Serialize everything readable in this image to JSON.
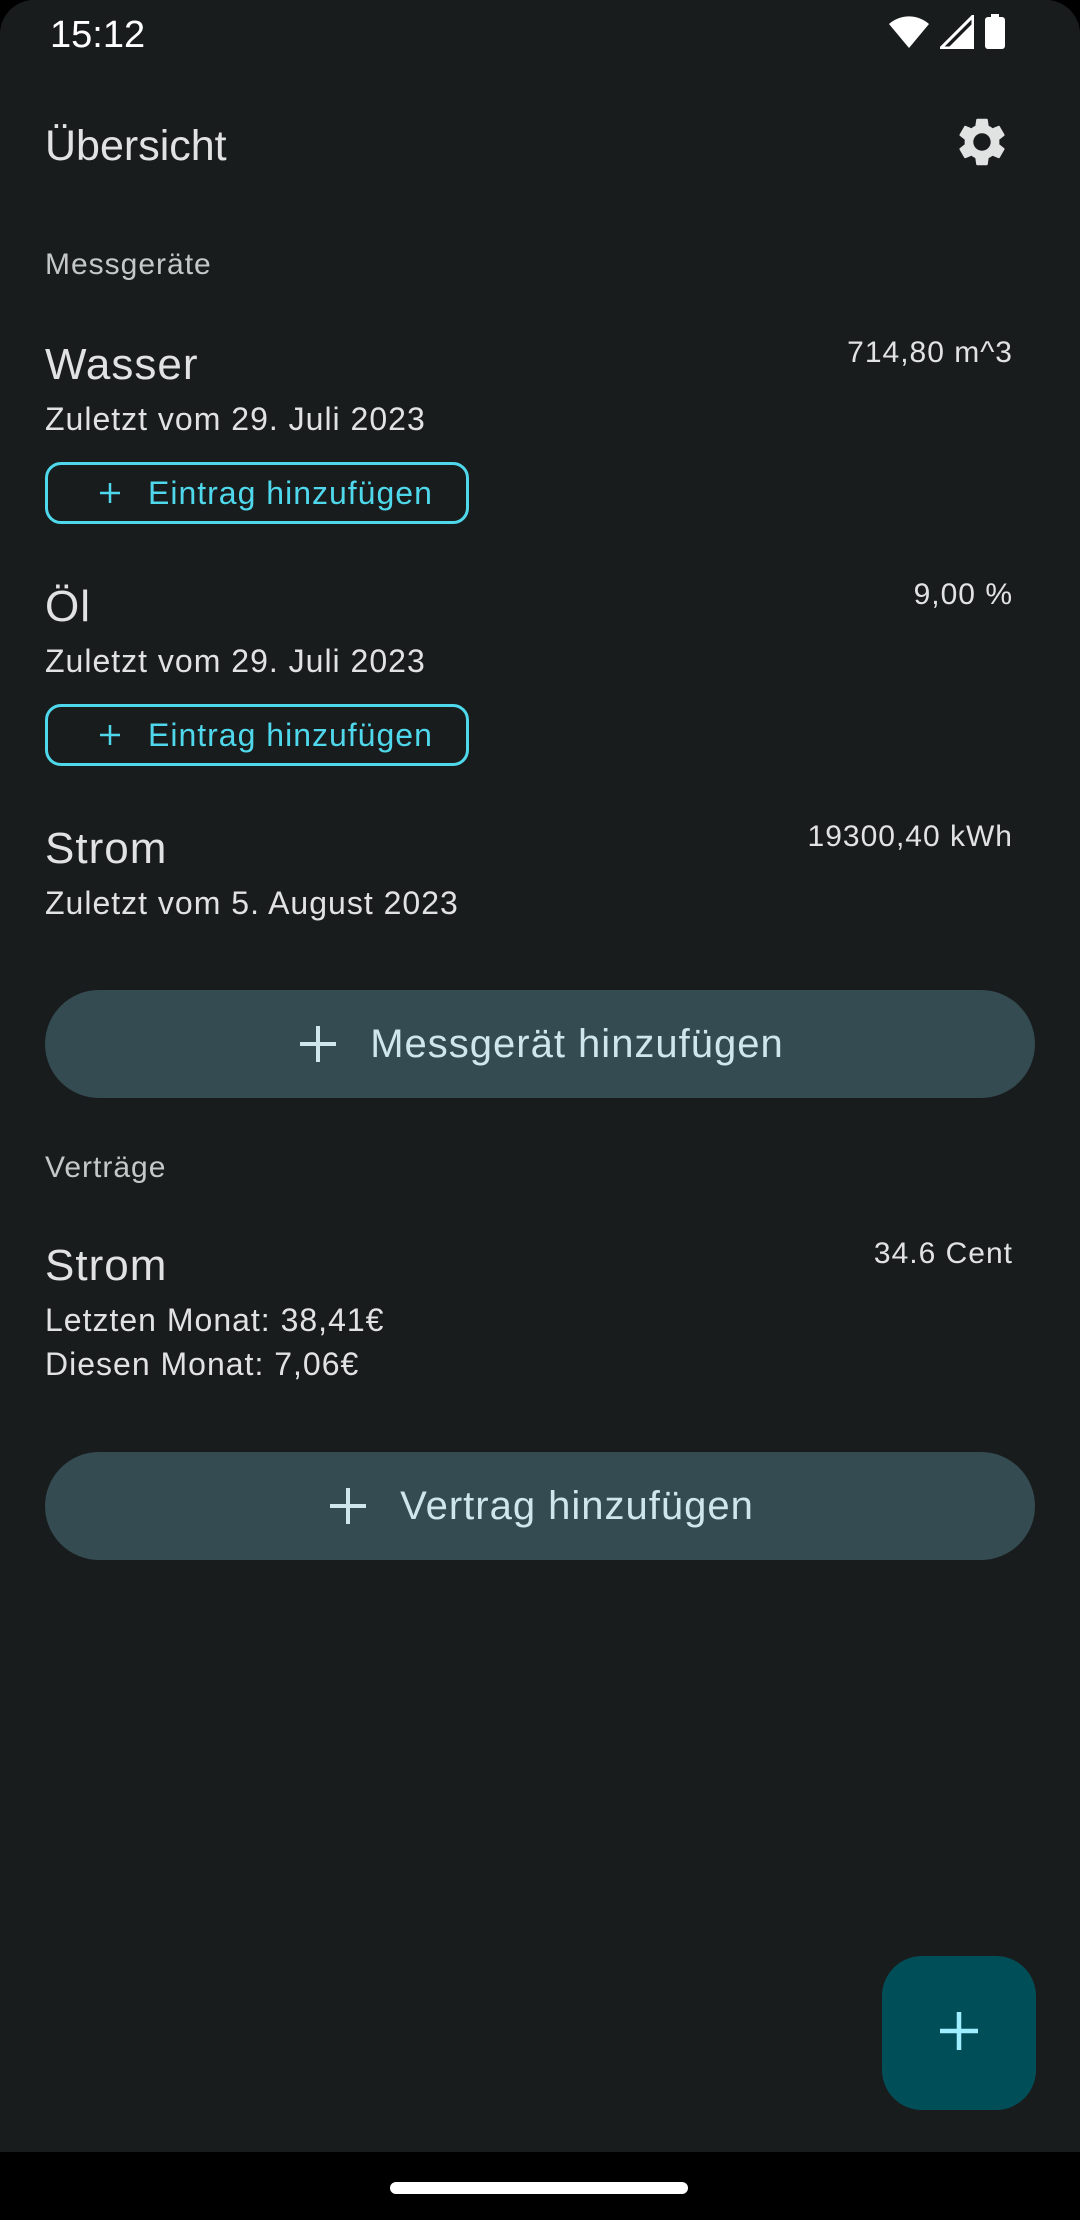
{
  "status_bar": {
    "time": "15:12",
    "icons": [
      "wifi-icon",
      "signal-icon",
      "battery-icon"
    ]
  },
  "app_bar": {
    "title": "Übersicht",
    "settings_icon": "gear-icon"
  },
  "meters": {
    "section_label": "Messgeräte",
    "items": [
      {
        "name": "Wasser",
        "subtitle": "Zuletzt vom 29. Juli 2023",
        "value": "714,80 m^3",
        "action_label": "Eintrag hinzufügen"
      },
      {
        "name": "Öl",
        "subtitle": "Zuletzt vom 29. Juli 2023",
        "value": "9,00 %",
        "action_label": "Eintrag hinzufügen"
      },
      {
        "name": "Strom",
        "subtitle": "Zuletzt vom 5. August 2023",
        "value": "19300,40 kWh"
      }
    ],
    "add_label": "Messgerät hinzufügen"
  },
  "contracts": {
    "section_label": "Verträge",
    "items": [
      {
        "name": "Strom",
        "value": "34.6 Cent",
        "last_month": "Letzten Monat: 38,41€",
        "this_month": "Diesen Monat: 7,06€"
      }
    ],
    "add_label": "Vertrag hinzufügen"
  },
  "fab": {
    "icon": "plus-icon"
  },
  "colors": {
    "background": "#191c1d",
    "accent": "#4fd8eb",
    "tonal_button": "#334b51",
    "fab": "#004f58"
  }
}
